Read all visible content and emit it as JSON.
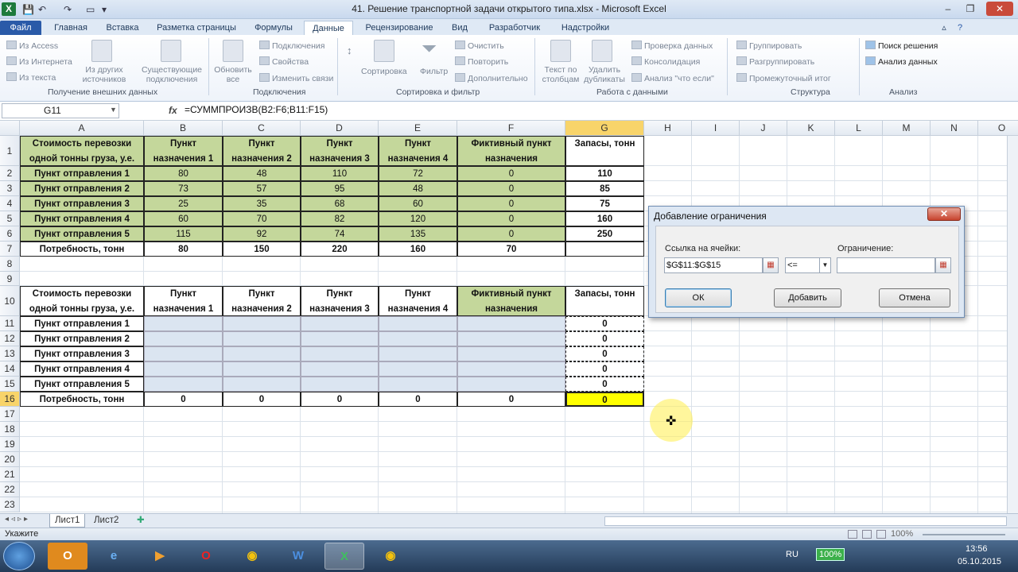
{
  "window": {
    "title": "41. Решение транспортной задачи открытого типа.xlsx - Microsoft Excel",
    "app_icon": "X"
  },
  "ribbon_tabs": [
    "Файл",
    "Главная",
    "Вставка",
    "Разметка страницы",
    "Формулы",
    "Данные",
    "Рецензирование",
    "Вид",
    "Разработчик",
    "Надстройки"
  ],
  "ribbon": {
    "get_external": {
      "from_access": "Из Access",
      "from_web": "Из Интернета",
      "from_text": "Из текста",
      "other_sources": "Из других источников",
      "existing": "Существующие подключения",
      "label": "Получение внешних данных"
    },
    "connections": {
      "refresh": "Обновить все",
      "connections": "Подключения",
      "properties": "Свойства",
      "edit_links": "Изменить связи",
      "label": "Подключения"
    },
    "sort": {
      "sort": "Сортировка",
      "filter": "Фильтр",
      "clear": "Очистить",
      "reapply": "Повторить",
      "advanced": "Дополнительно",
      "label": "Сортировка и фильтр"
    },
    "data_tools": {
      "text_to_cols": "Текст по столбцам",
      "remove_dups": "Удалить дубликаты",
      "validation": "Проверка данных",
      "consolidate": "Консолидация",
      "whatif": "Анализ \"что если\"",
      "label": "Работа с данными"
    },
    "outline": {
      "group": "Группировать",
      "ungroup": "Разгруппировать",
      "subtotal": "Промежуточный итог",
      "label": "Структура"
    },
    "analysis": {
      "solver": "Поиск решения",
      "data_analysis": "Анализ данных",
      "label": "Анализ"
    }
  },
  "formula_bar": {
    "name_box": "G11",
    "fx": "fx",
    "formula": "=СУММПРОИЗВ(B2:F6;B11:F15)"
  },
  "columns": [
    "A",
    "B",
    "C",
    "D",
    "E",
    "F",
    "G",
    "H",
    "I",
    "J",
    "K",
    "L",
    "M",
    "N",
    "O"
  ],
  "rows": [
    "1",
    "2",
    "3",
    "4",
    "5",
    "6",
    "7",
    "8",
    "9",
    "10",
    "11",
    "12",
    "13",
    "14",
    "15",
    "16",
    "17",
    "18",
    "19",
    "20",
    "21",
    "22",
    "23"
  ],
  "table1": {
    "corner": [
      "Стоимость перевозки",
      "одной тонны груза, у.е."
    ],
    "headers": [
      [
        "Пункт",
        "назначения 1"
      ],
      [
        "Пункт",
        "назначения 2"
      ],
      [
        "Пункт",
        "назначения 3"
      ],
      [
        "Пункт",
        "назначения 4"
      ],
      [
        "Фиктивный пункт",
        "назначения"
      ],
      [
        "",
        "Запасы, тонн"
      ]
    ],
    "row_labels": [
      "Пункт отправления 1",
      "Пункт отправления 2",
      "Пункт отправления 3",
      "Пункт отправления 4",
      "Пункт отправления 5"
    ],
    "values": [
      [
        "80",
        "48",
        "110",
        "72",
        "0",
        "110"
      ],
      [
        "73",
        "57",
        "95",
        "48",
        "0",
        "85"
      ],
      [
        "25",
        "35",
        "68",
        "60",
        "0",
        "75"
      ],
      [
        "60",
        "70",
        "82",
        "120",
        "0",
        "160"
      ],
      [
        "115",
        "92",
        "74",
        "135",
        "0",
        "250"
      ]
    ],
    "demand_label": "Потребность, тонн",
    "demand": [
      "80",
      "150",
      "220",
      "160",
      "70",
      ""
    ]
  },
  "table2": {
    "corner": [
      "Стоимость перевозки",
      "одной тонны груза, у.е."
    ],
    "headers": [
      [
        "Пункт",
        "назначения 1"
      ],
      [
        "Пункт",
        "назначения 2"
      ],
      [
        "Пункт",
        "назначения 3"
      ],
      [
        "Пункт",
        "назначения 4"
      ],
      [
        "Фиктивный пункт",
        "назначения"
      ],
      [
        "",
        "Запасы, тонн"
      ]
    ],
    "row_labels": [
      "Пункт отправления 1",
      "Пункт отправления 2",
      "Пункт отправления 3",
      "Пункт отправления 4",
      "Пункт отправления 5"
    ],
    "supply": [
      "0",
      "0",
      "0",
      "0",
      "0"
    ],
    "demand_label": "Потребность, тонн",
    "demand": [
      "0",
      "0",
      "0",
      "0",
      "0",
      "0"
    ]
  },
  "dialog": {
    "title": "Добавление ограничения",
    "close": "✕",
    "ref_label": "Ссылка на ячейки:",
    "ref_value": "$G$11:$G$15",
    "operator": "<=",
    "constraint_label": "Ограничение:",
    "constraint_value": "",
    "ok": "ОК",
    "add": "Добавить",
    "cancel": "Отмена"
  },
  "sheets": [
    "Лист1",
    "Лист2"
  ],
  "status": {
    "mode": "Укажите",
    "zoom": "100%"
  },
  "taskbar": {
    "lang": "RU",
    "battery": "100%",
    "time": "13:56",
    "date": "05.10.2015"
  },
  "colors": {
    "green_fill": "#c4d79b",
    "blue_fill": "#dbe5f1",
    "selected": "#ffff00",
    "tab_file": "#2a5aa8"
  }
}
